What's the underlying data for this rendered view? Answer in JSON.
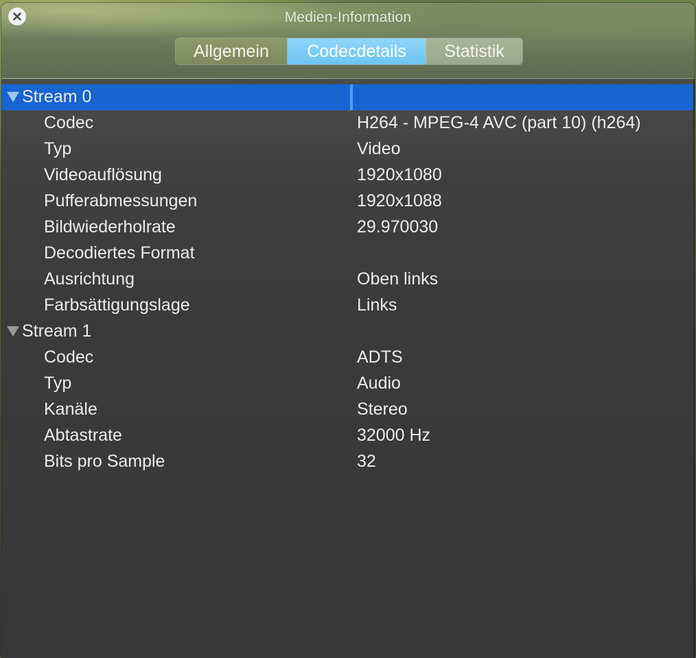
{
  "window": {
    "title": "Medien-Information",
    "close_icon": "close-icon"
  },
  "tabs": [
    {
      "label": "Allgemein",
      "selected": false
    },
    {
      "label": "Codecdetails",
      "selected": true
    },
    {
      "label": "Statistik",
      "selected": false
    }
  ],
  "colors": {
    "selection": "#1864d2",
    "active_tab": "#6ec4f3",
    "text": "#ececec"
  },
  "streams": [
    {
      "label": "Stream 0",
      "expanded": true,
      "selected": true,
      "properties": [
        {
          "key": "Codec",
          "value": "H264 - MPEG-4 AVC (part 10) (h264)"
        },
        {
          "key": "Typ",
          "value": "Video"
        },
        {
          "key": "Videoauflösung",
          "value": "1920x1080"
        },
        {
          "key": "Pufferabmessungen",
          "value": "1920x1088"
        },
        {
          "key": "Bildwiederholrate",
          "value": "29.970030"
        },
        {
          "key": "Decodiertes Format",
          "value": ""
        },
        {
          "key": "Ausrichtung",
          "value": "Oben links"
        },
        {
          "key": "Farbsättigungslage",
          "value": "Links"
        }
      ]
    },
    {
      "label": "Stream 1",
      "expanded": true,
      "selected": false,
      "properties": [
        {
          "key": "Codec",
          "value": "ADTS"
        },
        {
          "key": "Typ",
          "value": "Audio"
        },
        {
          "key": "Kanäle",
          "value": "Stereo"
        },
        {
          "key": "Abtastrate",
          "value": "32000 Hz"
        },
        {
          "key": "Bits pro Sample",
          "value": "32"
        }
      ]
    }
  ]
}
